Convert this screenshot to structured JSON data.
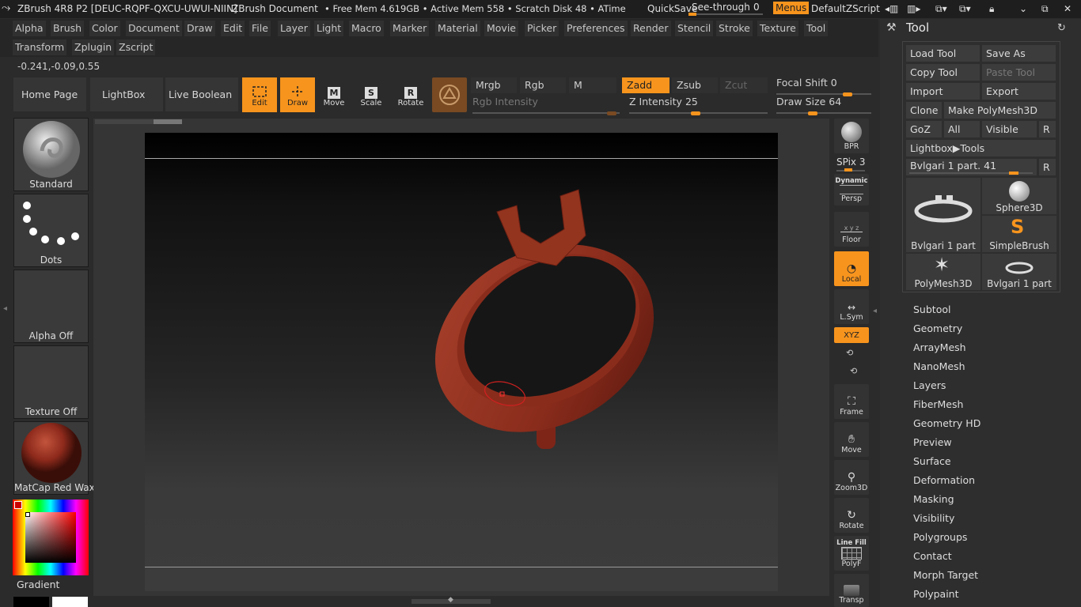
{
  "titlebar": {
    "app": "ZBrush 4R8 P2 [DEUC-RQPF-QXCU-UWUI-NIIN]",
    "document": "ZBrush Document",
    "mem": "• Free Mem 4.619GB • Active Mem 558 • Scratch Disk 48 • ATime",
    "quicksave": "QuickSave",
    "see_through_label": "See-through",
    "see_through_value": "0",
    "menus": "Menus",
    "zscript": "DefaultZScript"
  },
  "menus": {
    "row1": [
      "Alpha",
      "Brush",
      "Color",
      "Document",
      "Draw",
      "Edit",
      "File",
      "Layer",
      "Light",
      "Macro",
      "Marker",
      "Material",
      "Movie",
      "Picker",
      "Preferences",
      "Render",
      "Stencil",
      "Stroke",
      "Texture",
      "Tool"
    ],
    "row2": [
      "Transform",
      "Zplugin",
      "Zscript"
    ]
  },
  "coords": "-0.241,-0.09,0.55",
  "toolbar": {
    "home": "Home Page",
    "lightbox": "LightBox",
    "live_boolean": "Live Boolean",
    "edit": "Edit",
    "draw": "Draw",
    "move": "Move",
    "scale": "Scale",
    "rotate": "Rotate",
    "mrgb": "Mrgb",
    "rgb": "Rgb",
    "m": "M",
    "zadd": "Zadd",
    "zsub": "Zsub",
    "zcut": "Zcut",
    "rgb_intensity": "Rgb Intensity",
    "z_intensity_label": "Z Intensity",
    "z_intensity_value": "25",
    "focal_shift_label": "Focal Shift",
    "focal_shift_value": "0",
    "draw_size_label": "Draw Size",
    "draw_size_value": "64"
  },
  "left": {
    "brush": "Standard",
    "stroke": "Dots",
    "alpha": "Alpha Off",
    "texture": "Texture Off",
    "material": "MatCap Red Wax",
    "gradient": "Gradient"
  },
  "rightbar": {
    "bpr": "BPR",
    "spix_label": "SPix",
    "spix_value": "3",
    "dynamic": "Dynamic",
    "persp": "Persp",
    "floor": "Floor",
    "local": "Local",
    "lsym": "L.Sym",
    "xyz": "XYZ",
    "frame": "Frame",
    "move": "Move",
    "zoom3d": "Zoom3D",
    "rotate": "Rotate",
    "line_fill": "Line Fill",
    "polyf": "PolyF",
    "transp": "Transp"
  },
  "tool_panel": {
    "title": "Tool",
    "load_tool": "Load Tool",
    "save_as": "Save As",
    "copy_tool": "Copy Tool",
    "paste_tool": "Paste Tool",
    "import": "Import",
    "export": "Export",
    "clone": "Clone",
    "make_polymesh": "Make PolyMesh3D",
    "goz": "GoZ",
    "all": "All",
    "visible": "Visible",
    "r": "R",
    "lightbox_tools": "Lightbox▶Tools",
    "current_tool_label": "Bvlgari 1 part.",
    "current_tool_value": "41",
    "tiles": [
      "Bvlgari 1 part",
      "Sphere3D",
      "SimpleBrush",
      "PolyMesh3D",
      "Bvlgari 1 part"
    ],
    "subpalettes": [
      "Subtool",
      "Geometry",
      "ArrayMesh",
      "NanoMesh",
      "Layers",
      "FiberMesh",
      "Geometry HD",
      "Preview",
      "Surface",
      "Deformation",
      "Masking",
      "Visibility",
      "Polygroups",
      "Contact",
      "Morph Target",
      "Polypaint"
    ]
  },
  "colors": {
    "accent": "#f7941d",
    "material": "#8e2a1c"
  }
}
